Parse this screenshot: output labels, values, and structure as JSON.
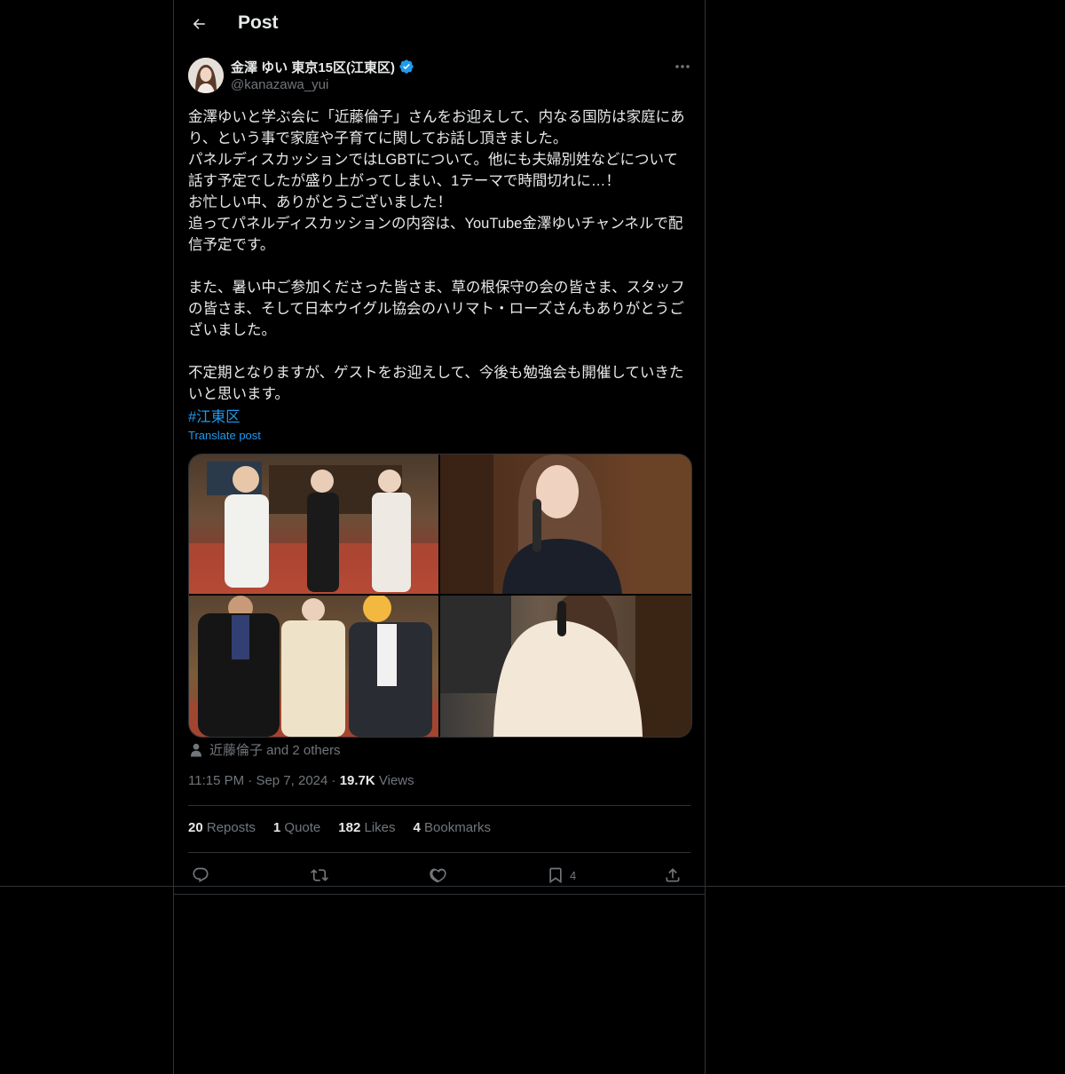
{
  "header": {
    "title": "Post"
  },
  "author": {
    "display_name": "金澤 ゆい 東京15区(江東区)",
    "handle": "@kanazawa_yui",
    "verified": true
  },
  "post": {
    "text": "金澤ゆいと学ぶ会に「近藤倫子」さんをお迎えして、内なる国防は家庭にあり、という事で家庭や子育てに関してお話し頂きました。\nパネルディスカッションではLGBTについて。他にも夫婦別姓などについて話す予定でしたが盛り上がってしまい、1テーマで時間切れに…！\nお忙しい中、ありがとうございました！\n追ってパネルディスカッションの内容は、YouTube金澤ゆいチャンネルで配信予定です。\n\nまた、暑い中ご参加くださった皆さま、草の根保守の会の皆さま、スタッフの皆さま、そして日本ウイグル協会のハリマト・ローズさんもありがとうございました。\n\n不定期となりますが、ゲストをお迎えして、今後も勉強会も開催していきたいと思います。",
    "hashtag": "#江東区",
    "translate_label": "Translate post",
    "tagged": "近藤倫子 and 2 others",
    "time": "11:15 PM",
    "date": "Sep 7, 2024",
    "views_count": "19.7K",
    "views_label": "Views"
  },
  "stats": {
    "reposts_count": "20",
    "reposts_label": "Reposts",
    "quotes_count": "1",
    "quotes_label": "Quote",
    "likes_count": "182",
    "likes_label": "Likes",
    "bookmarks_count": "4",
    "bookmarks_label": "Bookmarks"
  },
  "actions": {
    "bookmark_count": "4"
  },
  "colors": {
    "background": "#000000",
    "border": "#2f3336",
    "text_primary": "#e7e9ea",
    "text_secondary": "#71767b",
    "accent": "#1d9bf0"
  },
  "icons": [
    "back-arrow-icon",
    "verified-badge-icon",
    "more-icon",
    "person-icon",
    "reply-icon",
    "repost-icon",
    "like-icon",
    "bookmark-icon",
    "share-icon"
  ]
}
